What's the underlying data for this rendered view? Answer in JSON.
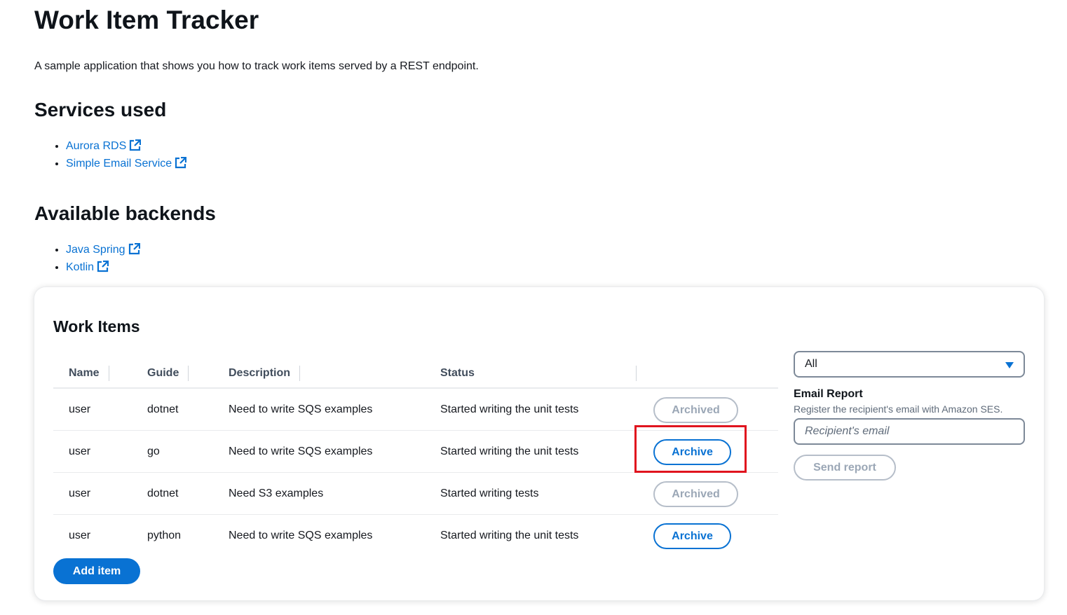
{
  "header": {
    "title": "Work Item Tracker",
    "description": "A sample application that shows you how to track work items served by a REST endpoint."
  },
  "services": {
    "heading": "Services used",
    "links": [
      "Aurora RDS",
      "Simple Email Service"
    ]
  },
  "backends": {
    "heading": "Available backends",
    "links": [
      "Java Spring",
      "Kotlin"
    ]
  },
  "work_items": {
    "title": "Work Items",
    "columns": [
      "Name",
      "Guide",
      "Description",
      "Status"
    ],
    "rows": [
      {
        "name": "user",
        "guide": "dotnet",
        "description": "Need to write SQS examples",
        "status": "Started writing the unit tests",
        "action": "Archived",
        "archived": true
      },
      {
        "name": "user",
        "guide": "go",
        "description": "Need to write SQS examples",
        "status": "Started writing the unit tests",
        "action": "Archive",
        "archived": false
      },
      {
        "name": "user",
        "guide": "dotnet",
        "description": "Need S3 examples",
        "status": "Started writing tests",
        "action": "Archived",
        "archived": true
      },
      {
        "name": "user",
        "guide": "python",
        "description": "Need to write SQS examples",
        "status": "Started writing the unit tests",
        "action": "Archive",
        "archived": false
      }
    ],
    "add_button": "Add item"
  },
  "filter": {
    "selected": "All"
  },
  "email_report": {
    "label": "Email Report",
    "hint": "Register the recipient's email with Amazon SES.",
    "placeholder": "Recipient's email",
    "value": "",
    "send_button": "Send report"
  },
  "colors": {
    "link": "#0972d3",
    "primary": "#0972d3",
    "disabled": "#9ba7b6",
    "highlight": "#e0141e"
  },
  "icons": {
    "external_link": "external-link-icon",
    "dropdown": "caret-down-icon"
  }
}
